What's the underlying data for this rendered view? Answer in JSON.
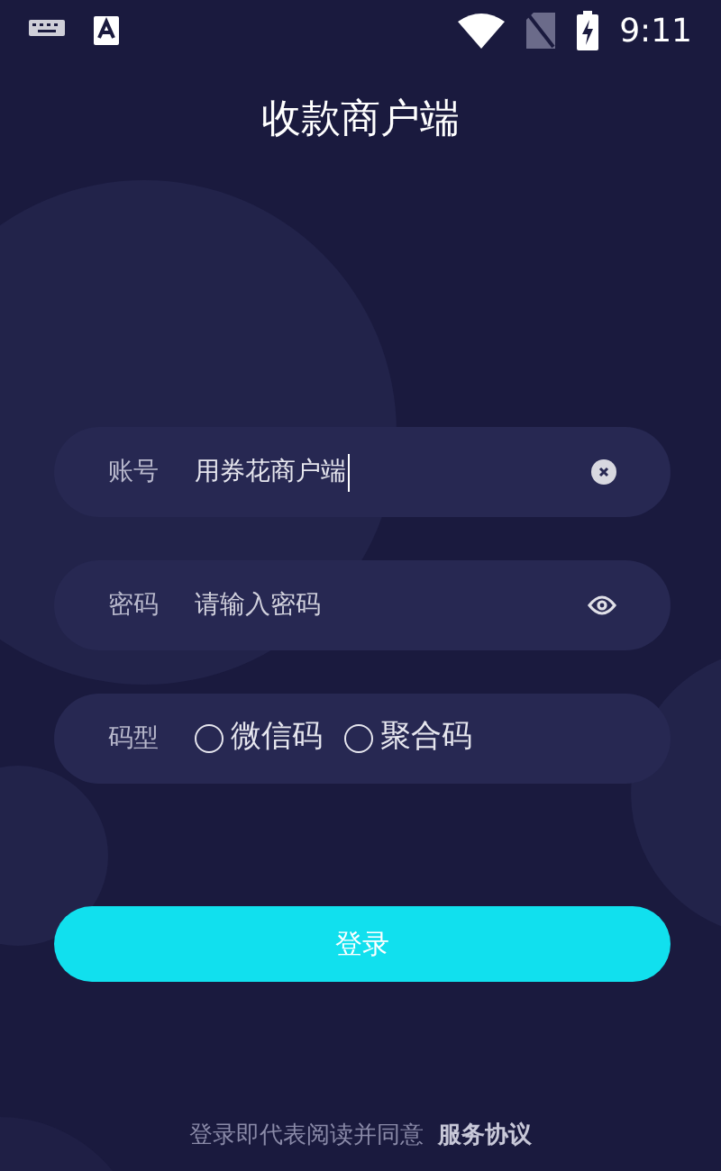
{
  "status_bar": {
    "time": "9:11"
  },
  "title": "收款商户端",
  "account": {
    "label": "账号",
    "value": "用券花商户端"
  },
  "password": {
    "label": "密码",
    "placeholder": "请输入密码"
  },
  "code_type": {
    "label": "码型",
    "options": [
      {
        "label": "微信码",
        "selected": false
      },
      {
        "label": "聚合码",
        "selected": false
      }
    ]
  },
  "login_button": "登录",
  "agreement": {
    "text": "登录即代表阅读并同意",
    "link": "服务协议"
  }
}
